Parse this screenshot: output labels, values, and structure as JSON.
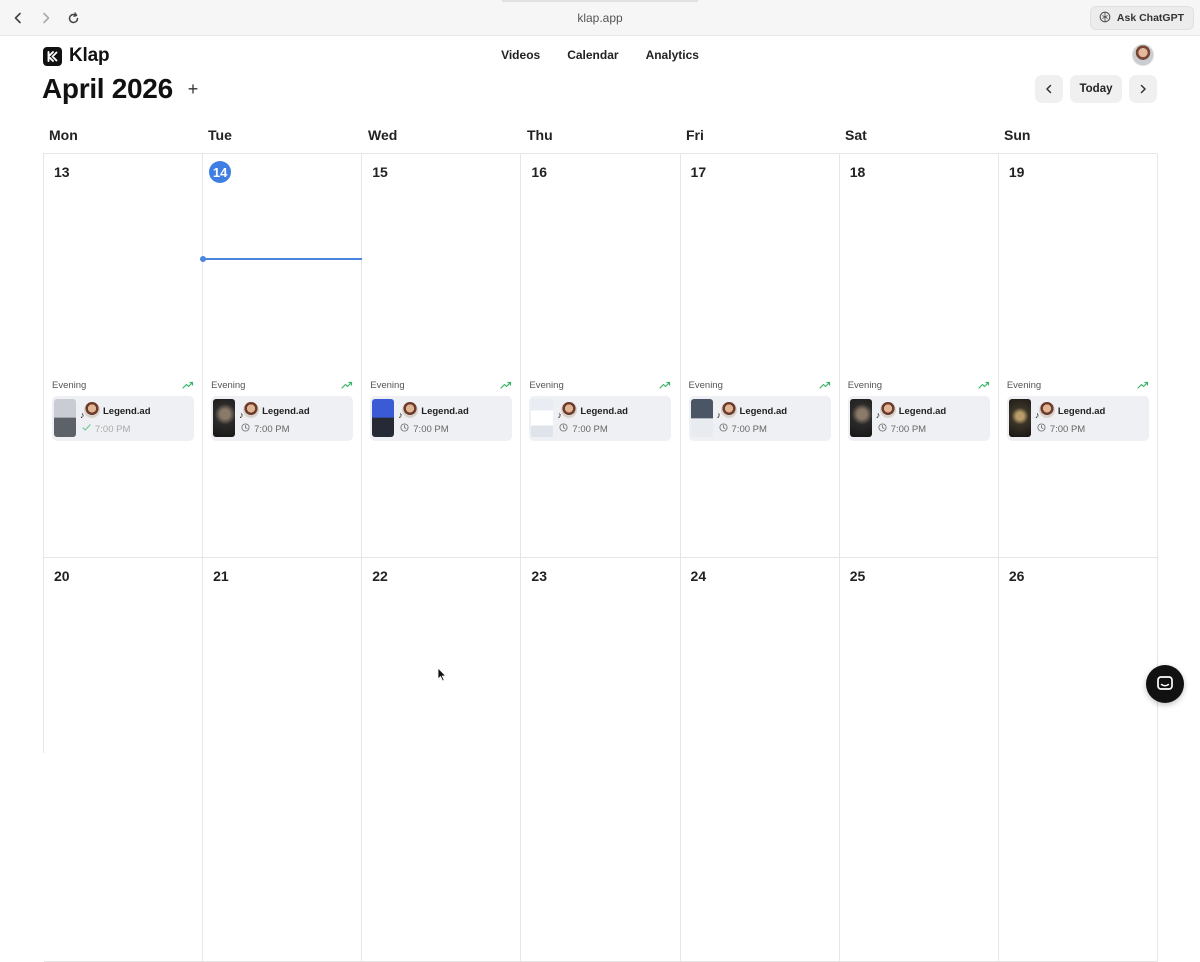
{
  "browser": {
    "url": "klap.app",
    "ask_label": "Ask ChatGPT"
  },
  "app": {
    "name": "Klap",
    "nav": [
      "Videos",
      "Calendar",
      "Analytics"
    ]
  },
  "calendar": {
    "month_label": "April 2026",
    "add_icon": "plus-icon",
    "today_label": "Today",
    "weekdays": [
      "Mon",
      "Tue",
      "Wed",
      "Thu",
      "Fri",
      "Sat",
      "Sun"
    ],
    "weeks": [
      {
        "days": [
          {
            "day": "13",
            "slot": "Evening",
            "account": "Legend.ad",
            "time": "7:00 PM",
            "posted": true,
            "thumb": "gray"
          },
          {
            "day": "14",
            "today": true,
            "slot": "Evening",
            "account": "Legend.ad",
            "time": "7:00 PM",
            "thumb": "dark"
          },
          {
            "day": "15",
            "slot": "Evening",
            "account": "Legend.ad",
            "time": "7:00 PM",
            "thumb": "blue"
          },
          {
            "day": "16",
            "slot": "Evening",
            "account": "Legend.ad",
            "time": "7:00 PM",
            "thumb": "light"
          },
          {
            "day": "17",
            "slot": "Evening",
            "account": "Legend.ad",
            "time": "7:00 PM",
            "thumb": "mixed"
          },
          {
            "day": "18",
            "slot": "Evening",
            "account": "Legend.ad",
            "time": "7:00 PM",
            "thumb": "dark"
          },
          {
            "day": "19",
            "slot": "Evening",
            "account": "Legend.ad",
            "time": "7:00 PM",
            "thumb": "gold"
          }
        ]
      },
      {
        "days": [
          {
            "day": "20"
          },
          {
            "day": "21"
          },
          {
            "day": "22"
          },
          {
            "day": "23"
          },
          {
            "day": "24"
          },
          {
            "day": "25"
          },
          {
            "day": "26"
          }
        ]
      }
    ]
  },
  "colors": {
    "accent": "#3f7fe3",
    "trend": "#3bb56a",
    "card_bg": "#eef0f3"
  }
}
